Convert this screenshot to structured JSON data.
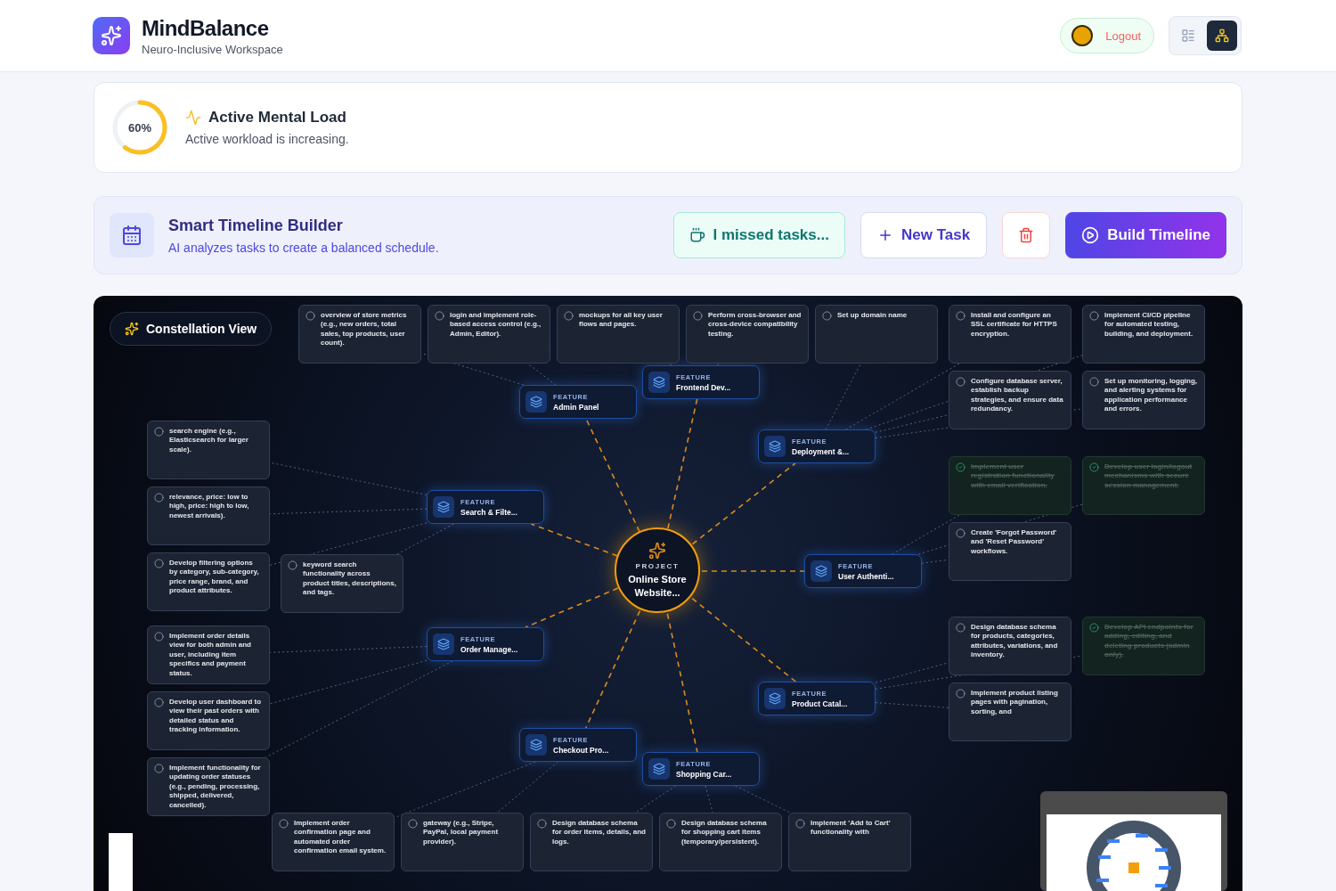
{
  "header": {
    "app_name": "MindBalance",
    "tagline": "Neuro-Inclusive Workspace",
    "logout": "Logout",
    "views": [
      {
        "kind": "list",
        "selected": false
      },
      {
        "kind": "graph",
        "selected": true
      }
    ]
  },
  "mental_load": {
    "level": 0.6,
    "percent": "60%",
    "title": "Active Mental Load",
    "message": "Active workload is increasing."
  },
  "timeline_builder": {
    "title": "Smart Timeline Builder",
    "subtitle": "AI analyzes tasks to create a balanced schedule.",
    "buttons": [
      {
        "kind": "missed",
        "label": "I missed tasks..."
      },
      {
        "kind": "new",
        "label": "New Task"
      },
      {
        "kind": "delete"
      },
      {
        "kind": "build",
        "label": "Build Timeline"
      }
    ]
  },
  "constellation": {
    "badge": "Constellation View",
    "project": {
      "tag": "PROJECT",
      "name": "Online Store Website..."
    },
    "features": [
      {
        "tag": "FEATURE",
        "name": "Frontend Dev...",
        "tasks": [
          {
            "text": "mockups for all key user flows and pages.",
            "done": false
          },
          {
            "text": "Perform cross-browser and cross-device compatibility testing.",
            "done": false
          }
        ]
      },
      {
        "tag": "FEATURE",
        "name": "Admin Panel",
        "tasks": [
          {
            "text": "overview of store metrics (e.g., new orders, total sales, top products, user count).",
            "done": false
          },
          {
            "text": "login and implement role-based access control (e.g., Admin, Editor).",
            "done": false
          }
        ]
      },
      {
        "tag": "FEATURE",
        "name": "Deployment &...",
        "tasks": [
          {
            "text": "Set up domain name",
            "done": false
          },
          {
            "text": "Install and configure an SSL certificate for HTTPS encryption.",
            "done": false
          },
          {
            "text": "Implement CI/CD pipeline for automated testing, building, and deployment.",
            "done": false
          },
          {
            "text": "Configure database server, establish backup strategies, and ensure data redundancy.",
            "done": false
          },
          {
            "text": "Set up monitoring, logging, and alerting systems for application performance and errors.",
            "done": false
          }
        ]
      },
      {
        "tag": "FEATURE",
        "name": "Search & Filte...",
        "tasks": [
          {
            "text": "search engine (e.g., Elasticsearch for larger scale).",
            "done": false
          },
          {
            "text": "relevance, price: low to high, price: high to low, newest arrivals).",
            "done": false
          },
          {
            "text": "Develop filtering options by category, sub-category, price range, brand, and product attributes.",
            "done": false
          },
          {
            "text": "keyword search functionality across product titles, descriptions, and tags.",
            "done": false
          }
        ]
      },
      {
        "tag": "FEATURE",
        "name": "User Authenti...",
        "tasks": [
          {
            "text": "Implement user registration functionality with email verification.",
            "done": true
          },
          {
            "text": "Develop user login/logout mechanisms with secure session management.",
            "done": true
          },
          {
            "text": "Create 'Forgot Password' and 'Reset Password' workflows.",
            "done": false
          }
        ]
      },
      {
        "tag": "FEATURE",
        "name": "Order Manage...",
        "tasks": [
          {
            "text": "Implement order details view for both admin and user, including item specifics and payment status.",
            "done": false
          },
          {
            "text": "Develop user dashboard to view their past orders with detailed status and tracking information.",
            "done": false
          },
          {
            "text": "Implement functionality for updating order statuses (e.g., pending, processing, shipped, delivered, cancelled).",
            "done": false
          }
        ]
      },
      {
        "tag": "FEATURE",
        "name": "Product Catal...",
        "tasks": [
          {
            "text": "Design database schema for products, categories, attributes, variations, and inventory.",
            "done": false
          },
          {
            "text": "Develop API endpoints for adding, editing, and deleting products (admin only).",
            "done": true
          },
          {
            "text": "Implement product listing pages with pagination, sorting, and",
            "done": false
          }
        ]
      },
      {
        "tag": "FEATURE",
        "name": "Checkout Pro...",
        "tasks": [
          {
            "text": "Implement order confirmation page and automated order confirmation email system.",
            "done": false
          },
          {
            "text": "gateway (e.g., Stripe, PayPal, local payment provider).",
            "done": false
          }
        ]
      },
      {
        "tag": "FEATURE",
        "name": "Shopping Car...",
        "tasks": [
          {
            "text": "Design database schema for order items, details, and logs.",
            "done": false
          },
          {
            "text": "Design database schema for shopping cart items (temporary/persistent).",
            "done": false
          },
          {
            "text": "Implement 'Add to Cart' functionality with",
            "done": false
          }
        ]
      }
    ]
  }
}
